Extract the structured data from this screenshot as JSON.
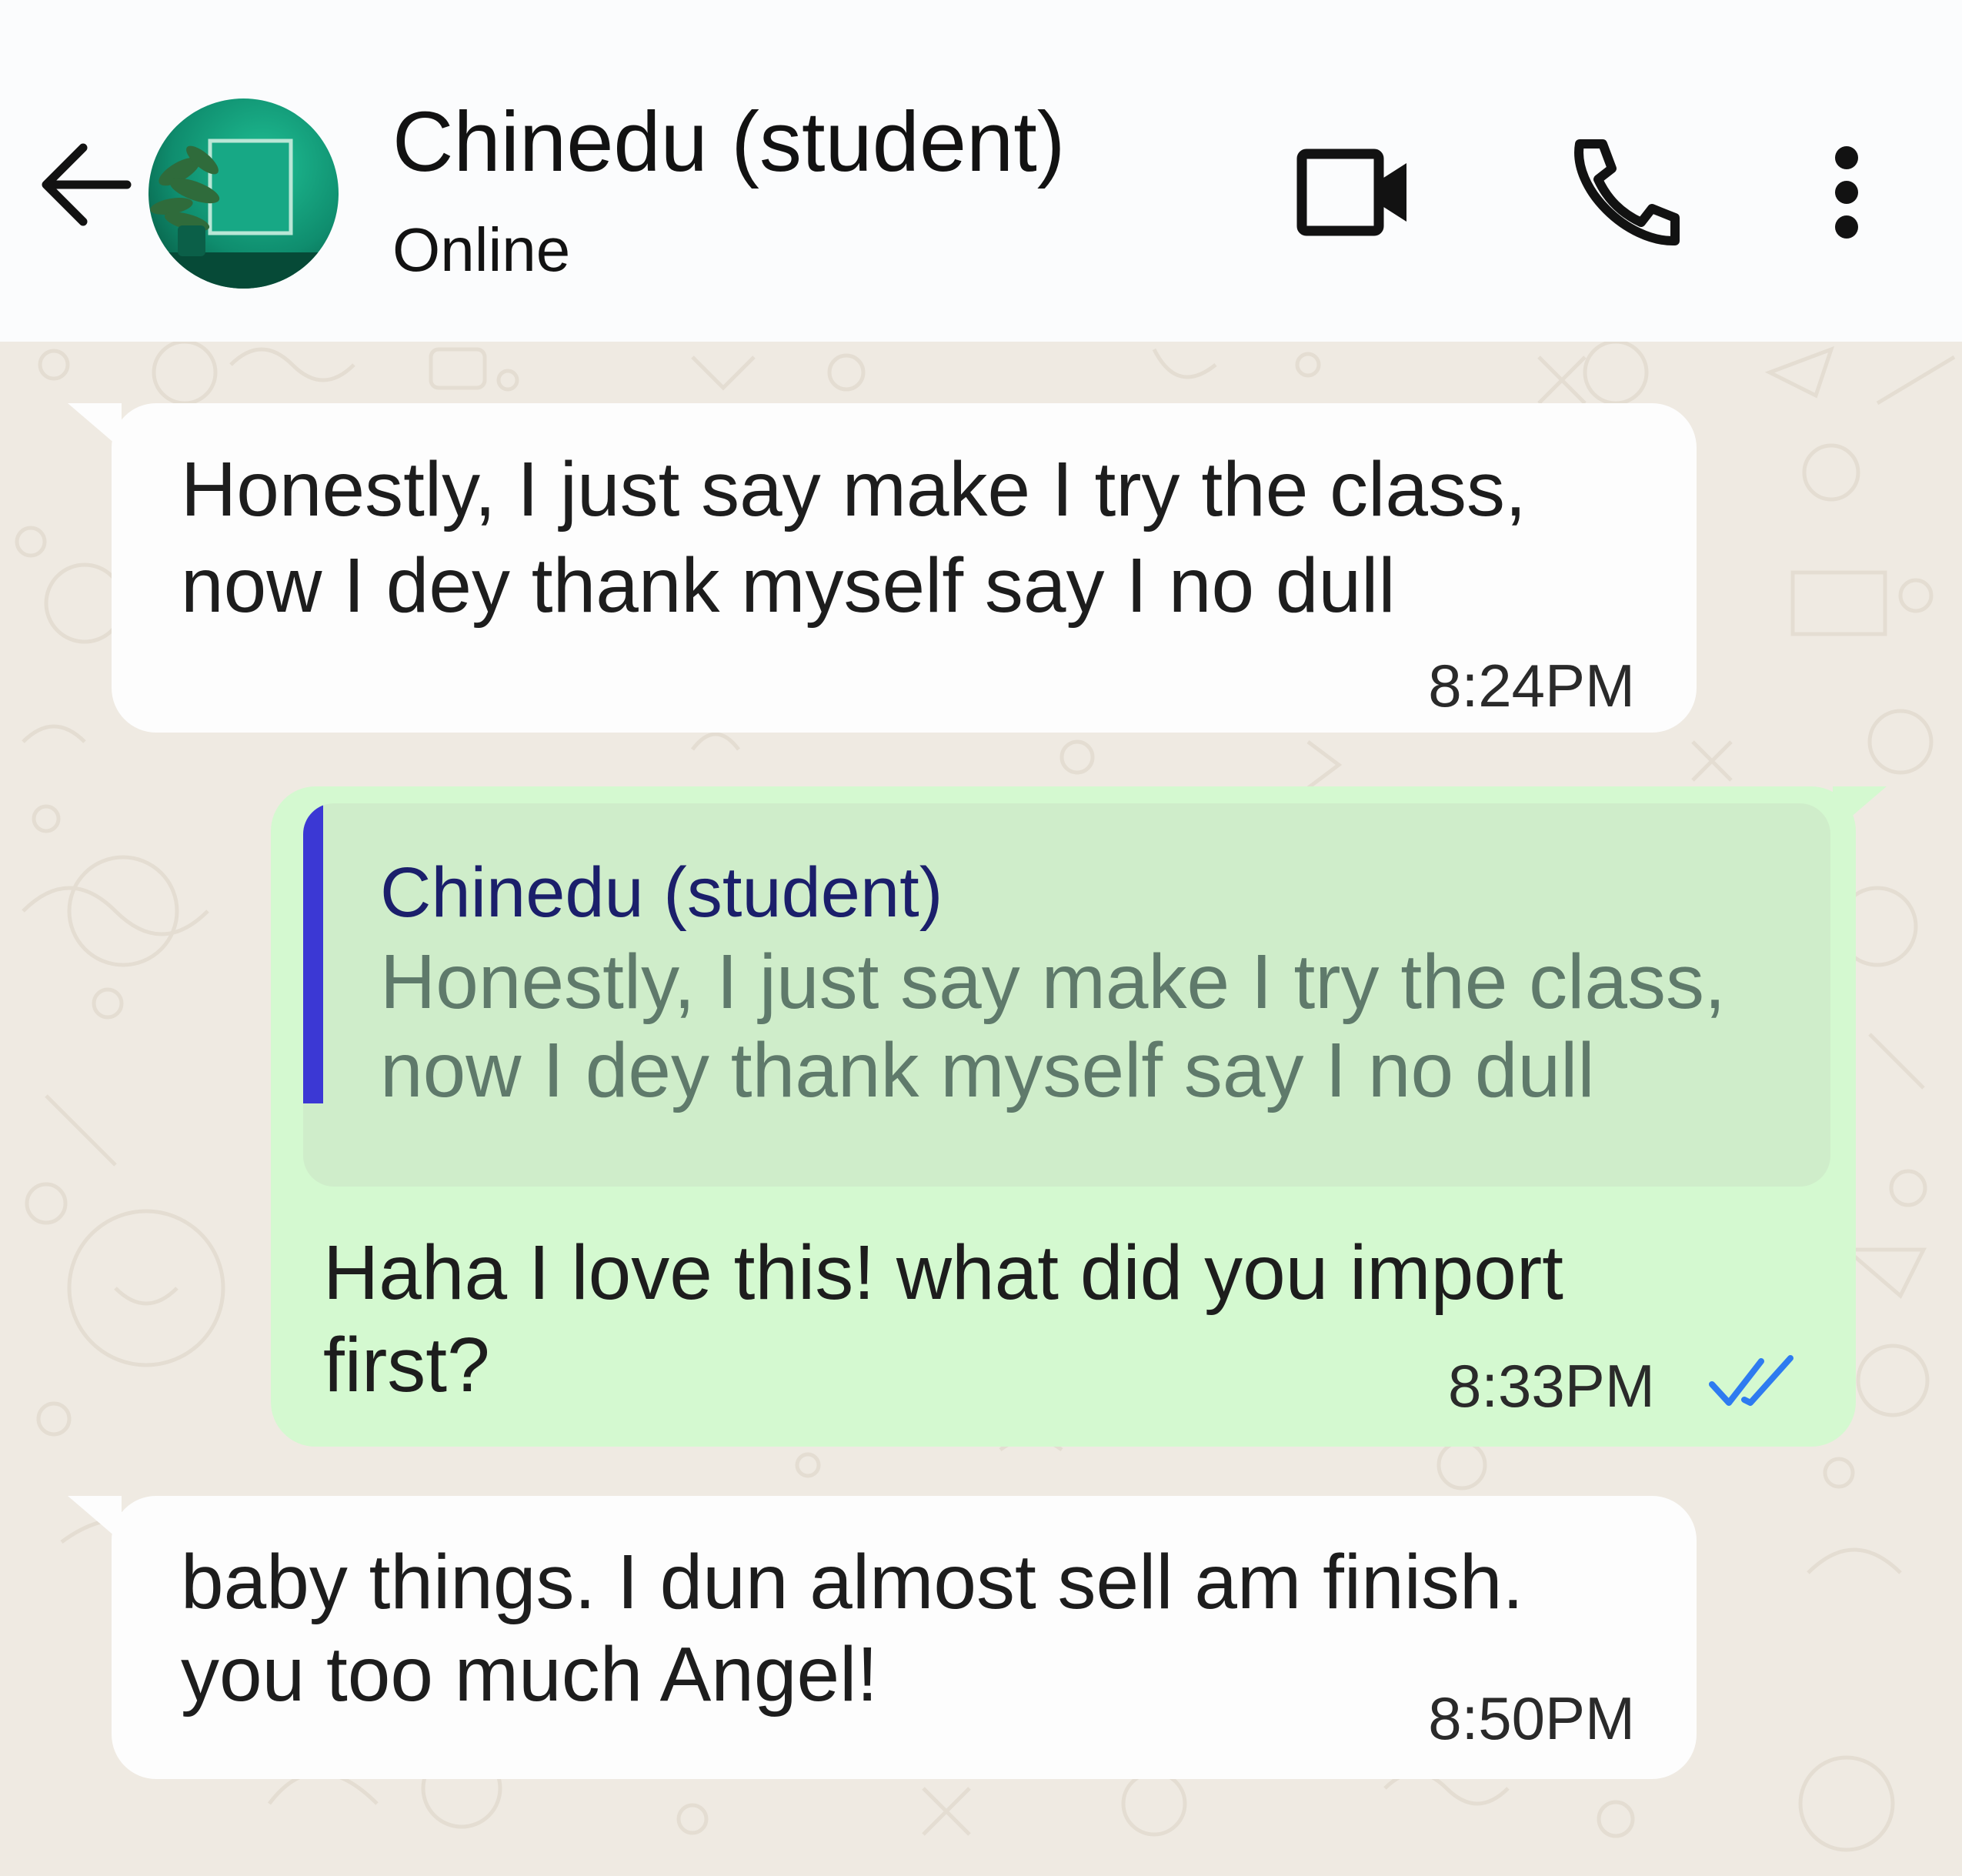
{
  "header": {
    "contact_name": "Chinedu (student)",
    "status": "Online",
    "icons": {
      "back": "arrow-left-icon",
      "video": "video-camera-icon",
      "call": "phone-icon",
      "menu": "more-vertical-icon"
    }
  },
  "messages": [
    {
      "direction": "incoming",
      "lines": [
        "Honestly, I just say make I try the class,",
        "now I dey thank myself say I no dull"
      ],
      "time": "8:24PM"
    },
    {
      "direction": "outgoing",
      "quote": {
        "author": "Chinedu (student)",
        "lines": [
          "Honestly, I just say make I try the class,",
          "now I dey thank myself say I no dull"
        ]
      },
      "lines": [
        "Haha I love this! what did you import",
        "first?"
      ],
      "time": "8:33PM",
      "status": "read"
    },
    {
      "direction": "incoming",
      "lines": [
        "baby things. I dun almost sell am finish.",
        "you too much Angel!"
      ],
      "time": "8:50PM"
    }
  ],
  "colors": {
    "header_bg": "#fbfcfd",
    "chat_bg": "#efeae2",
    "incoming_bubble": "#fdfdfd",
    "outgoing_bubble": "#d4f9d0",
    "quote_bg": "#cfedca",
    "quote_bar": "#3b38d4",
    "read_ticks": "#2e7bf0"
  }
}
